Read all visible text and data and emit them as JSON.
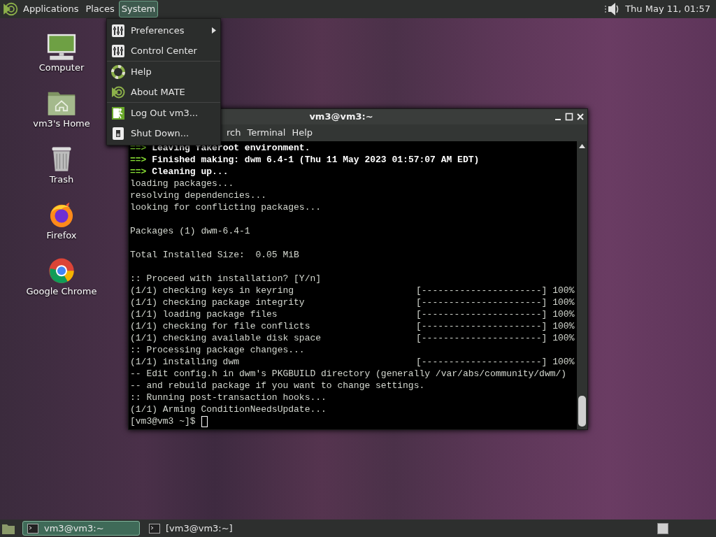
{
  "top_panel": {
    "menus": [
      {
        "label": "Applications",
        "selected": false
      },
      {
        "label": "Places",
        "selected": false
      },
      {
        "label": "System",
        "selected": true
      }
    ],
    "clock": "Thu May 11, 01:57"
  },
  "system_menu": {
    "sections": [
      [
        {
          "label": "Preferences",
          "kind": "prefs",
          "submenu": true
        },
        {
          "label": "Control Center",
          "kind": "prefs",
          "submenu": false
        }
      ],
      [
        {
          "label": "Help",
          "kind": "help",
          "submenu": false
        },
        {
          "label": "About MATE",
          "kind": "mate",
          "submenu": false
        }
      ],
      [
        {
          "label": "Log Out vm3...",
          "kind": "logout",
          "submenu": false
        },
        {
          "label": "Shut Down...",
          "kind": "shutdown",
          "submenu": false
        }
      ]
    ]
  },
  "desktop_icons": [
    {
      "label": "Computer",
      "kind": "computer"
    },
    {
      "label": "vm3's Home",
      "kind": "home"
    },
    {
      "label": "Trash",
      "kind": "trash"
    },
    {
      "label": "Firefox",
      "kind": "firefox"
    },
    {
      "label": "Google Chrome",
      "kind": "chrome"
    }
  ],
  "terminal": {
    "title": "vm3@vm3:~",
    "menu": [
      "rch",
      "Terminal",
      "Help"
    ],
    "lines": [
      {
        "kind": "step",
        "arrow": "==>",
        "text": "Leaving fakeroot environment."
      },
      {
        "kind": "step",
        "arrow": "==>",
        "text": "Finished making: dwm 6.4-1 (Thu 11 May 2023 01:57:07 AM EDT)"
      },
      {
        "kind": "step",
        "arrow": "==>",
        "text": "Cleaning up..."
      },
      {
        "kind": "plain",
        "text": "loading packages..."
      },
      {
        "kind": "plain",
        "text": "resolving dependencies..."
      },
      {
        "kind": "plain",
        "text": "looking for conflicting packages..."
      },
      {
        "kind": "blank"
      },
      {
        "kind": "plain",
        "text": "Packages (1) dwm-6.4-1"
      },
      {
        "kind": "blank"
      },
      {
        "kind": "plain",
        "text": "Total Installed Size:  0.05 MiB"
      },
      {
        "kind": "blank"
      },
      {
        "kind": "plain",
        "text": ":: Proceed with installation? [Y/n]"
      },
      {
        "kind": "progress",
        "text": "(1/1) checking keys in keyring",
        "bar": "[----------------------]",
        "percent": "100%"
      },
      {
        "kind": "progress",
        "text": "(1/1) checking package integrity",
        "bar": "[----------------------]",
        "percent": "100%"
      },
      {
        "kind": "progress",
        "text": "(1/1) loading package files",
        "bar": "[----------------------]",
        "percent": "100%"
      },
      {
        "kind": "progress",
        "text": "(1/1) checking for file conflicts",
        "bar": "[----------------------]",
        "percent": "100%"
      },
      {
        "kind": "progress",
        "text": "(1/1) checking available disk space",
        "bar": "[----------------------]",
        "percent": "100%"
      },
      {
        "kind": "plain",
        "text": ":: Processing package changes..."
      },
      {
        "kind": "progress",
        "text": "(1/1) installing dwm",
        "bar": "[----------------------]",
        "percent": "100%"
      },
      {
        "kind": "plain",
        "text": "-- Edit config.h in dwm's PKGBUILD directory (generally /var/abs/community/dwm/)"
      },
      {
        "kind": "plain",
        "text": "-- and rebuild package if you want to change settings."
      },
      {
        "kind": "plain",
        "text": ":: Running post-transaction hooks..."
      },
      {
        "kind": "plain",
        "text": "(1/1) Arming ConditionNeedsUpdate..."
      },
      {
        "kind": "prompt",
        "text": "[vm3@vm3 ~]$"
      }
    ]
  },
  "taskbar": {
    "windows": [
      {
        "label": "vm3@vm3:~",
        "selected": true
      },
      {
        "label": "[vm3@vm3:~]",
        "selected": false
      }
    ]
  }
}
